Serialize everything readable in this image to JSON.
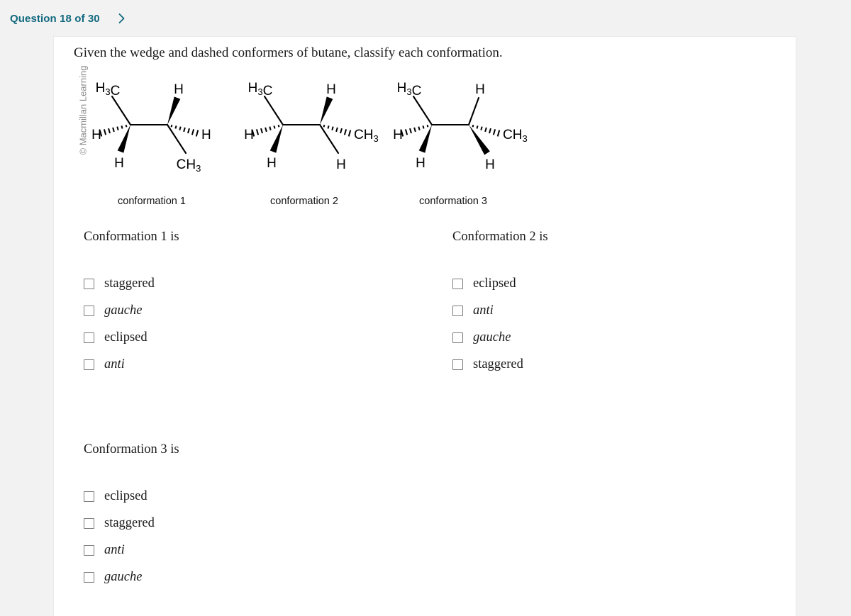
{
  "header": {
    "question_counter": "Question 18 of 30",
    "next_icon": "chevron-right-icon",
    "accent_color": "#11697f"
  },
  "watermark": {
    "text": "© Macmillan Learning"
  },
  "prompt": {
    "text": "Given the wedge and dashed conformers of butane, classify each conformation."
  },
  "figures": [
    {
      "caption": "conformation 1",
      "left_carbon": {
        "up_left": {
          "label": "H3C",
          "bond": "plain"
        },
        "left": {
          "label": "H",
          "bond": "hashed"
        },
        "down_left": {
          "label": "H",
          "bond": "wedge"
        }
      },
      "right_carbon": {
        "up_right": {
          "label": "H",
          "bond": "wedge"
        },
        "right": {
          "label": "H",
          "bond": "hashed"
        },
        "down_right": {
          "label": "CH3",
          "bond": "plain"
        }
      }
    },
    {
      "caption": "conformation 2",
      "left_carbon": {
        "up_left": {
          "label": "H3C",
          "bond": "plain"
        },
        "left": {
          "label": "H",
          "bond": "hashed"
        },
        "down_left": {
          "label": "H",
          "bond": "wedge"
        }
      },
      "right_carbon": {
        "up_right": {
          "label": "H",
          "bond": "wedge"
        },
        "right": {
          "label": "CH3",
          "bond": "hashed"
        },
        "down_right": {
          "label": "H",
          "bond": "plain"
        }
      }
    },
    {
      "caption": "conformation 3",
      "left_carbon": {
        "up_left": {
          "label": "H3C",
          "bond": "plain"
        },
        "left": {
          "label": "H",
          "bond": "hashed"
        },
        "down_left": {
          "label": "H",
          "bond": "wedge"
        }
      },
      "right_carbon": {
        "up_right": {
          "label": "H",
          "bond": "plain"
        },
        "right": {
          "label": "CH3",
          "bond": "hashed"
        },
        "down_right": {
          "label": "H",
          "bond": "wedge"
        }
      }
    }
  ],
  "answer_groups": [
    {
      "heading": "Conformation 1 is",
      "options": [
        {
          "label": "staggered",
          "italic": false,
          "checked": false
        },
        {
          "label": "gauche",
          "italic": true,
          "checked": false
        },
        {
          "label": "eclipsed",
          "italic": false,
          "checked": false
        },
        {
          "label": "anti",
          "italic": true,
          "checked": false
        }
      ]
    },
    {
      "heading": "Conformation 2 is",
      "options": [
        {
          "label": "eclipsed",
          "italic": false,
          "checked": false
        },
        {
          "label": "anti",
          "italic": true,
          "checked": false
        },
        {
          "label": "gauche",
          "italic": true,
          "checked": false
        },
        {
          "label": "staggered",
          "italic": false,
          "checked": false
        }
      ]
    },
    {
      "heading": "Conformation 3 is",
      "options": [
        {
          "label": "eclipsed",
          "italic": false,
          "checked": false
        },
        {
          "label": "staggered",
          "italic": false,
          "checked": false
        },
        {
          "label": "anti",
          "italic": true,
          "checked": false
        },
        {
          "label": "gauche",
          "italic": true,
          "checked": false
        }
      ]
    }
  ]
}
